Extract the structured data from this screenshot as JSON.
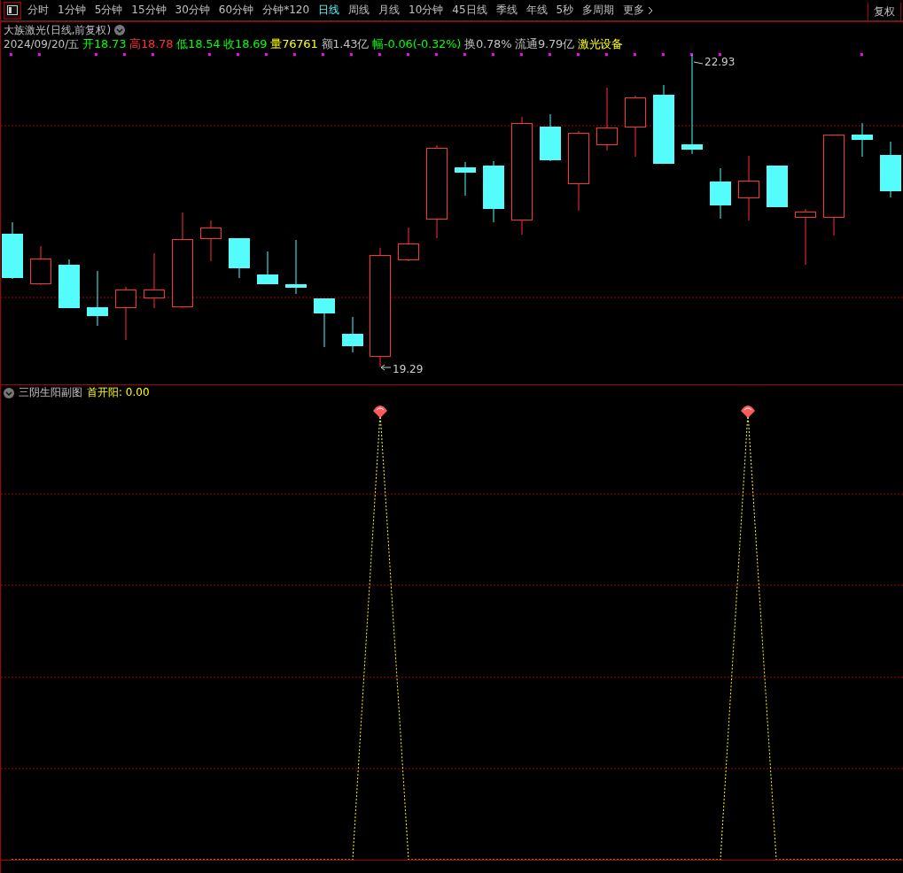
{
  "toolbar": {
    "tabs": [
      {
        "label": "分时",
        "selected": false
      },
      {
        "label": "1分钟",
        "selected": false
      },
      {
        "label": "5分钟",
        "selected": false
      },
      {
        "label": "15分钟",
        "selected": false
      },
      {
        "label": "30分钟",
        "selected": false
      },
      {
        "label": "60分钟",
        "selected": false
      },
      {
        "label": "分钟*120",
        "selected": false
      },
      {
        "label": "日线",
        "selected": true
      },
      {
        "label": "周线",
        "selected": false
      },
      {
        "label": "月线",
        "selected": false
      },
      {
        "label": "10分钟",
        "selected": false
      },
      {
        "label": "45日线",
        "selected": false
      },
      {
        "label": "季线",
        "selected": false
      },
      {
        "label": "年线",
        "selected": false
      },
      {
        "label": "5秒",
        "selected": false
      },
      {
        "label": "多周期",
        "selected": false
      }
    ],
    "more": "更多",
    "adjust_button": "复权"
  },
  "stock": {
    "title": "大族激光(日线,前复权)",
    "date": "2024/09/20/五",
    "quotes": [
      {
        "text": "开18.73",
        "color": "#00ff00"
      },
      {
        "text": "高18.78",
        "color": "#ff3232"
      },
      {
        "text": "低18.54",
        "color": "#00ff00"
      },
      {
        "text": "收18.69",
        "color": "#00ff00"
      },
      {
        "text": "量76761",
        "color": "#ffff00"
      },
      {
        "text": "额1.43亿",
        "color": "#c0c0c0"
      },
      {
        "text": "幅-0.06(-0.32%)",
        "color": "#00ff00"
      },
      {
        "text": "换0.78%",
        "color": "#c0c0c0"
      },
      {
        "text": "流通9.79亿",
        "color": "#c0c0c0"
      },
      {
        "text": "激光设备",
        "color": "#ffff00"
      }
    ]
  },
  "main_chart": {
    "high_label": "22.93",
    "low_label": "19.29"
  },
  "sub_chart": {
    "title": "三阴生阳副图",
    "indicator": "首开阳: 0.00"
  }
}
